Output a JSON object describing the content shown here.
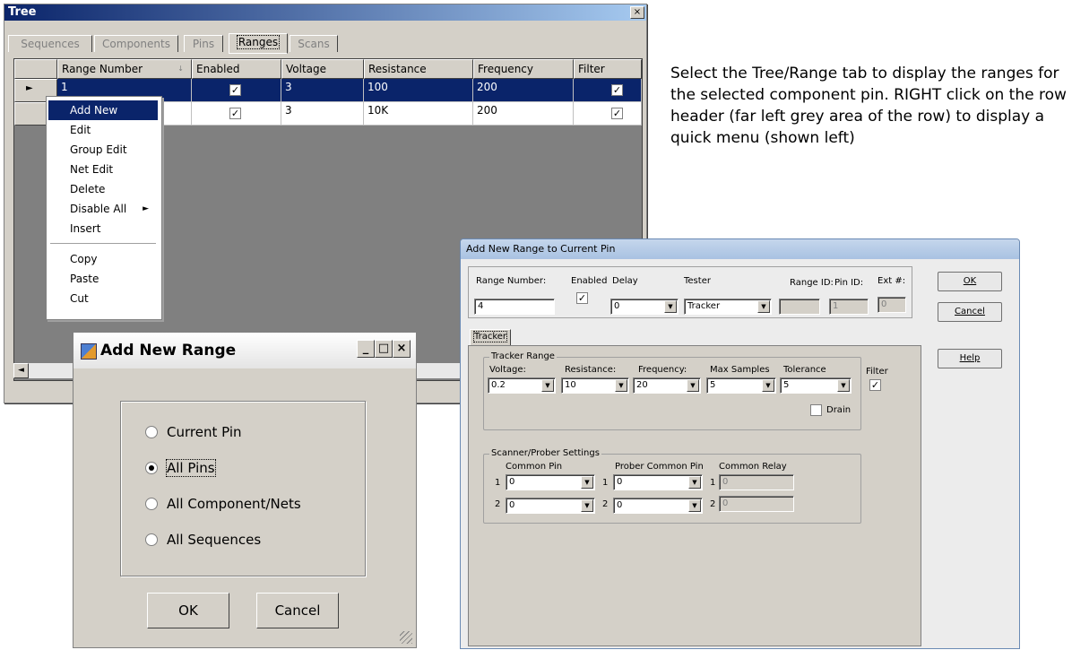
{
  "tree_window": {
    "title": "Tree",
    "close_glyph": "×",
    "tabs": [
      "Sequences",
      "Components",
      "Pins",
      "Ranges",
      "Scans"
    ],
    "active_tab": "Ranges",
    "columns": [
      "Range Number",
      "Enabled",
      "Voltage",
      "Resistance",
      "Frequency",
      "Filter"
    ],
    "sort_indicator": "↓",
    "rows": [
      {
        "range_number": "1",
        "enabled": true,
        "voltage": "3",
        "resistance": "100",
        "frequency": "200",
        "filter": true,
        "selected": true
      },
      {
        "range_number": "",
        "enabled": true,
        "voltage": "3",
        "resistance": "10K",
        "frequency": "200",
        "filter": true,
        "selected": false
      }
    ],
    "row_pointer_glyph": "►",
    "scroll_left_glyph": "◄"
  },
  "context_menu": {
    "items": [
      "Add New",
      "Edit",
      "Group Edit",
      "Net Edit",
      "Delete",
      "Disable All",
      "Insert"
    ],
    "items2": [
      "Copy",
      "Paste",
      "Cut"
    ],
    "highlighted": "Add New",
    "submenu_glyph": "►"
  },
  "add_new_range": {
    "title": "Add New Range",
    "options": [
      "Current Pin",
      "All Pins",
      "All Component/Nets",
      "All Sequences"
    ],
    "selected_option": "All Pins",
    "ok_label": "OK",
    "cancel_label": "Cancel",
    "min_glyph": "_",
    "max_glyph": "□",
    "close_glyph": "×"
  },
  "add_new_range_pin": {
    "title": "Add New Range to Current Pin",
    "labels": {
      "range_number": "Range Number:",
      "enabled": "Enabled",
      "delay": "Delay",
      "tester": "Tester",
      "range_id": "Range ID:",
      "pin_id": "Pin ID:",
      "ext": "Ext #:"
    },
    "values": {
      "range_number": "4",
      "enabled": true,
      "delay": "0",
      "tester": "Tracker",
      "range_id": "",
      "pin_id": "1",
      "ext": "0"
    },
    "buttons": {
      "ok": "OK",
      "cancel": "Cancel",
      "help": "Help"
    },
    "tab": "Tracker",
    "tracker_range": {
      "title": "Tracker Range",
      "labels": [
        "Voltage:",
        "Resistance:",
        "Frequency:",
        "Max Samples",
        "Tolerance",
        "Filter"
      ],
      "values": [
        "0.2",
        "10",
        "20",
        "5",
        "5"
      ],
      "filter": true,
      "drain_label": "Drain",
      "drain": false
    },
    "scanner": {
      "title": "Scanner/Prober Settings",
      "labels": [
        "Common Pin",
        "Prober Common Pin",
        "Common Relay"
      ],
      "row_numbers": [
        "1",
        "2"
      ],
      "common_pin": [
        "0",
        "0"
      ],
      "prober_common_pin": [
        "0",
        "0"
      ],
      "common_relay": [
        "0",
        "0"
      ]
    }
  },
  "description": "Select the Tree/Range tab to display the ranges for the selected component pin. RIGHT click on the row header (far left grey area of the row) to display a quick menu (shown left)"
}
